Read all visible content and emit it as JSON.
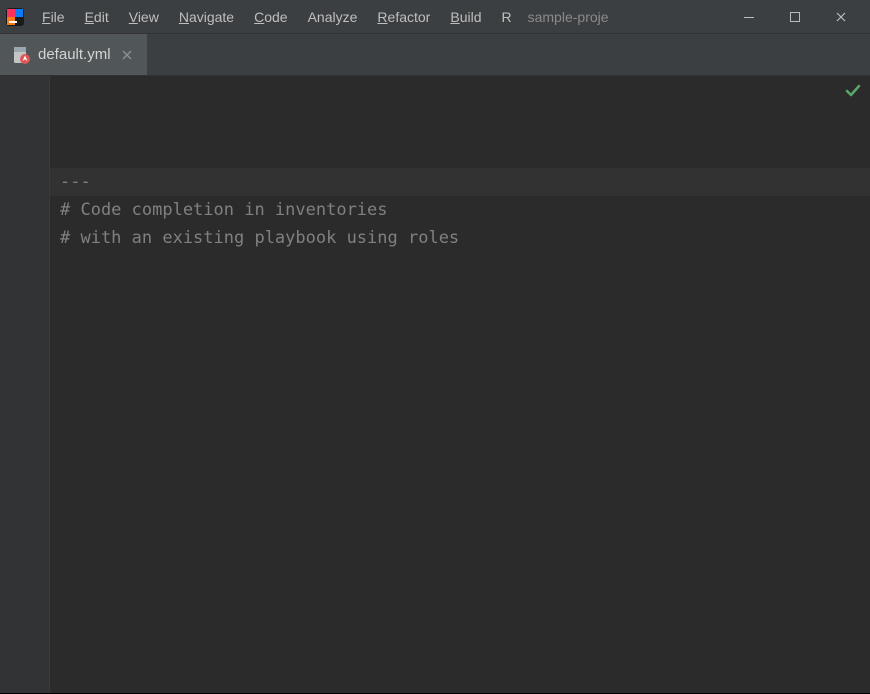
{
  "menubar": {
    "items": [
      {
        "label": "File",
        "mnemonic": "F"
      },
      {
        "label": "Edit",
        "mnemonic": "E"
      },
      {
        "label": "View",
        "mnemonic": "V"
      },
      {
        "label": "Navigate",
        "mnemonic": "N"
      },
      {
        "label": "Code",
        "mnemonic": "C"
      },
      {
        "label": "Analyze",
        "mnemonic": ""
      },
      {
        "label": "Refactor",
        "mnemonic": "R"
      },
      {
        "label": "Build",
        "mnemonic": "B"
      },
      {
        "label": "R",
        "mnemonic": ""
      }
    ],
    "project_name": "sample-proje"
  },
  "tabs": [
    {
      "filename": "default.yml"
    }
  ],
  "editor": {
    "lines": [
      "---",
      "# Code completion in inventories",
      "# with an existing playbook using roles",
      ""
    ]
  },
  "icons": {
    "app": "intellij-icon",
    "file": "yaml-ansible-icon",
    "status": "check-ok-icon"
  }
}
